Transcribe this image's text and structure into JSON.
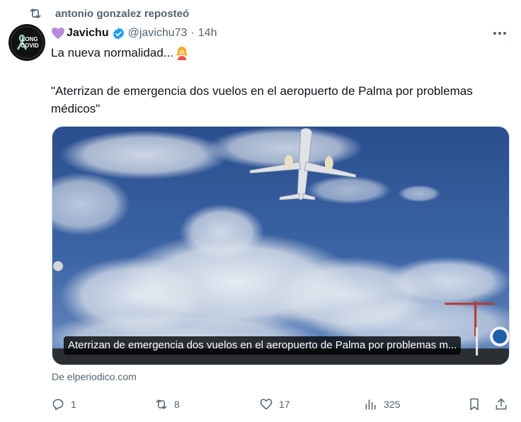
{
  "repost": {
    "text": "antonio gonzalez reposteó",
    "icon": "repost-icon"
  },
  "author": {
    "avatar_text": "LONG\nCOVID",
    "avatar_small": "LONG COVID",
    "name": "Javichu",
    "handle": "@javichu73",
    "separator": "·",
    "time": "14h",
    "verified_color": "#1d9bf0",
    "heart_emoji_color": "#b88ad9"
  },
  "tweet": {
    "line1": "La nueva normalidad...",
    "line2": "\"Aterrizan de emergencia dos vuelos en el aeropuerto de Palma por problemas médicos\""
  },
  "card": {
    "caption": "Aterrizan de emergencia dos vuelos en el aeropuerto de Palma por problemas m...",
    "source": "De elperiodico.com"
  },
  "actions": {
    "reply_count": "1",
    "repost_count": "8",
    "like_count": "17",
    "views_count": "325"
  },
  "colors": {
    "muted": "#536471",
    "text": "#0f1419"
  }
}
